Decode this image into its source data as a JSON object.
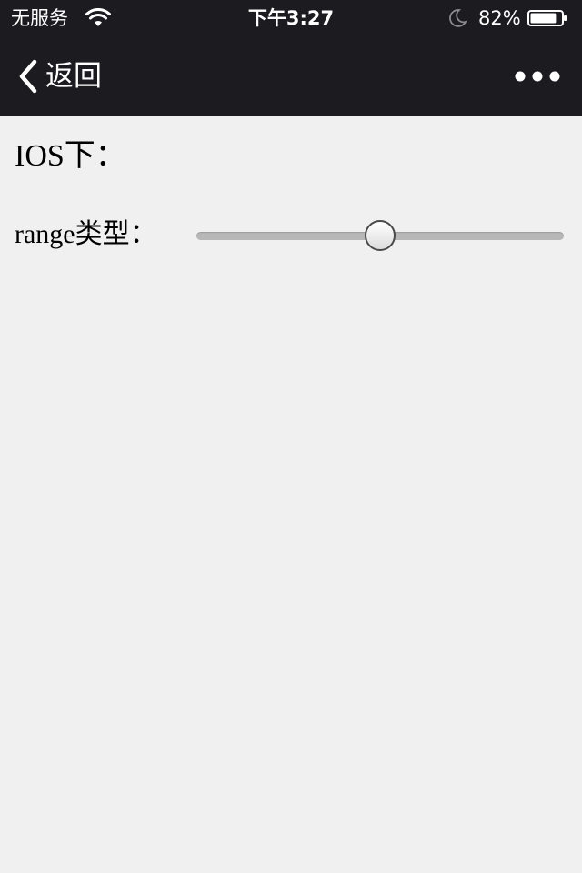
{
  "status_bar": {
    "carrier": "无服务",
    "time": "下午3:27",
    "battery_percent": "82%",
    "battery_level": 0.82,
    "icons": [
      "wifi-icon",
      "moon-icon",
      "battery-icon"
    ]
  },
  "nav_bar": {
    "back_label": "返回",
    "back_icon": "chevron-left-icon",
    "more_icon": "more-dots-icon"
  },
  "content": {
    "section_title": "IOS下：",
    "range_label": "range类型：",
    "range_value": 50,
    "range_min": 0,
    "range_max": 100
  },
  "colors": {
    "bar_background": "#1c1b20",
    "page_background": "#f0f0f0",
    "track": "#b7b7b7"
  }
}
